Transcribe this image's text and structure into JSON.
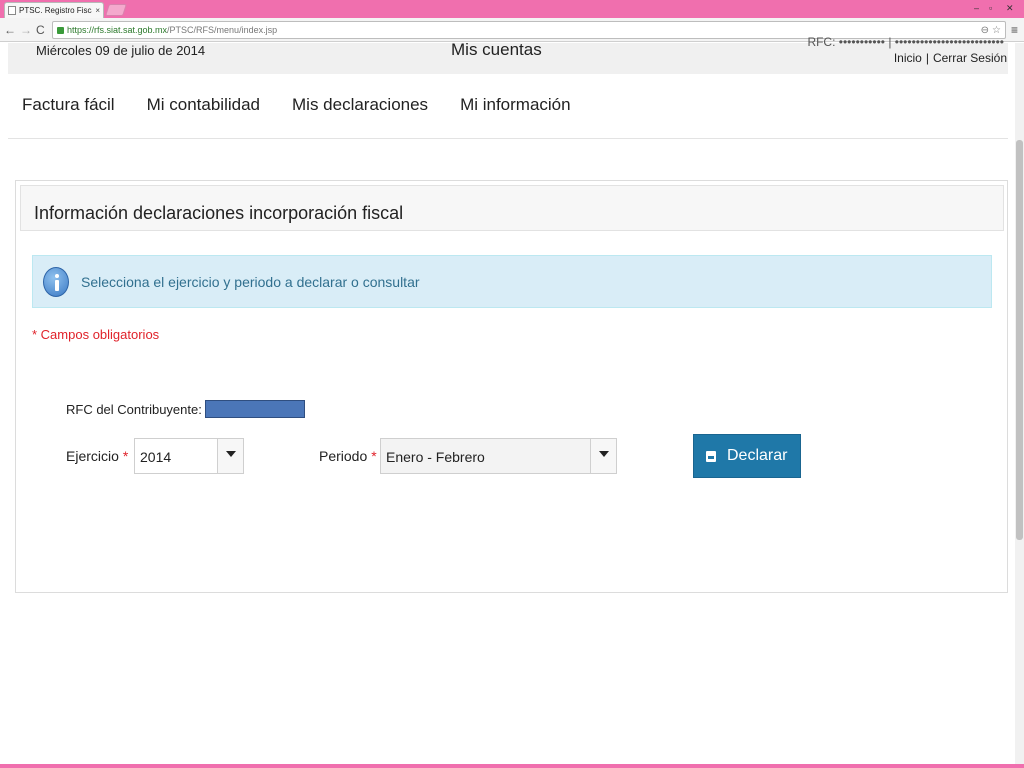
{
  "browser": {
    "tab_title": "PTSC. Registro Fiscal Simp",
    "tab_close": "×",
    "url_host": "https://rfs.siat.sat.gob.mx",
    "url_path": "/PTSC/RFS/menu/index.jsp",
    "win_min": "–",
    "win_max": "▫",
    "win_close": "✕",
    "nav_back": "←",
    "nav_forward": "→",
    "nav_reload": "C",
    "zoom_icon": "⊖",
    "star_icon": "☆",
    "menu_icon": "≡"
  },
  "header": {
    "date": "Miércoles 09 de julio de 2014",
    "title": "Mis cuentas",
    "user_info": "RFC: ••••••••••• | ••••••••••••••••••••••••••",
    "links": [
      "Inicio",
      "Cerrar Sesión"
    ],
    "separator": "|"
  },
  "nav": {
    "items": [
      "Factura fácil",
      "Mi contabilidad",
      "Mis declaraciones",
      "Mi información"
    ]
  },
  "panel": {
    "title": "Información declaraciones incorporación fiscal",
    "info": "Selecciona el ejercicio y periodo a declarar o consultar",
    "required_note": "* Campos obligatorios",
    "rfc_label": "RFC del Contribuyente:",
    "ejercicio_label": "Ejercicio",
    "ejercicio_value": "2014",
    "periodo_label": "Periodo",
    "periodo_value": "Enero - Febrero",
    "required_star": "*",
    "declarar_label": "Declarar"
  },
  "colors": {
    "accent": "#1f78a8",
    "info_bg": "#d9edf7",
    "info_text": "#31708f",
    "required": "#e0222a",
    "chrome": "#f06fae"
  }
}
